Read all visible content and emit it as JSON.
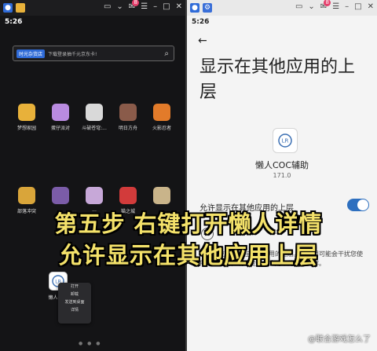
{
  "left": {
    "time": "5:26",
    "search": {
      "tag": "时光杂货店",
      "placeholder": "下载登录抽千元京东卡!"
    },
    "apps_row1": [
      {
        "label": "梦想家园",
        "color": "#e8b13a"
      },
      {
        "label": "蛋仔派对",
        "color": "#b98be0"
      },
      {
        "label": "斗破苍穹:...",
        "color": "#d9d9d9"
      },
      {
        "label": "明日方舟",
        "color": "#8a5b4a"
      },
      {
        "label": "火影忍者",
        "color": "#e27b2a"
      }
    ],
    "apps_row2": [
      {
        "label": "部落冲突",
        "color": "#d9a53a"
      },
      {
        "label": "...",
        "color": "#7b5ca8"
      },
      {
        "label": "...",
        "color": "#c7a8d8"
      },
      {
        "label": "猫之城",
        "color": "#d23b3b"
      },
      {
        "label": "...",
        "color": "#c9b48a"
      }
    ],
    "lazy_app": {
      "label": "懒人COC"
    },
    "context_menu": [
      "打开",
      "卸载",
      "发送到桌面",
      "详情"
    ]
  },
  "right": {
    "time": "5:26",
    "title": "显示在其他应用的上层",
    "app_name": "懒人COC辅助",
    "version": "171.0",
    "permission_label": "允许显示在其他应用的上层",
    "description": "允许此应用显示在其他应用的上层。此应用可能会干扰您使用其他应用，或改变其他应用中的显示内容。"
  },
  "overlay": {
    "line1": "第五步  右键打开懒人详情",
    "line2": "允许显示在其他应用上层"
  },
  "watermark": "@联合游戏怎么了",
  "colors": {
    "accent": "#2d6fbf",
    "caption": "#f4e26a"
  }
}
